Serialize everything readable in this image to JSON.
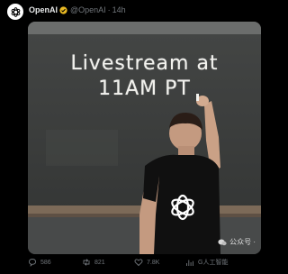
{
  "post": {
    "author_name": "OpenAI",
    "handle": "@OpenAI",
    "separator": "·",
    "time": "14h",
    "verified": true
  },
  "media": {
    "board_line_1": "Livestream at",
    "board_line_2": "11AM PT"
  },
  "actions": {
    "replies": "586",
    "reposts": "821",
    "likes": "7.8K",
    "views": "G人工智能"
  },
  "watermark": {
    "text": "公众号 ·"
  },
  "icons": {
    "avatar": "openai-logo-icon",
    "verified": "verified-badge-icon",
    "reply": "reply-icon",
    "repost": "repost-icon",
    "like": "heart-icon",
    "views": "views-icon"
  },
  "colors": {
    "background": "#000000",
    "text": "#e7e9ea",
    "muted": "#71767b",
    "verified_gold": "#e8b923",
    "chalkboard": "#3a3b3a"
  }
}
